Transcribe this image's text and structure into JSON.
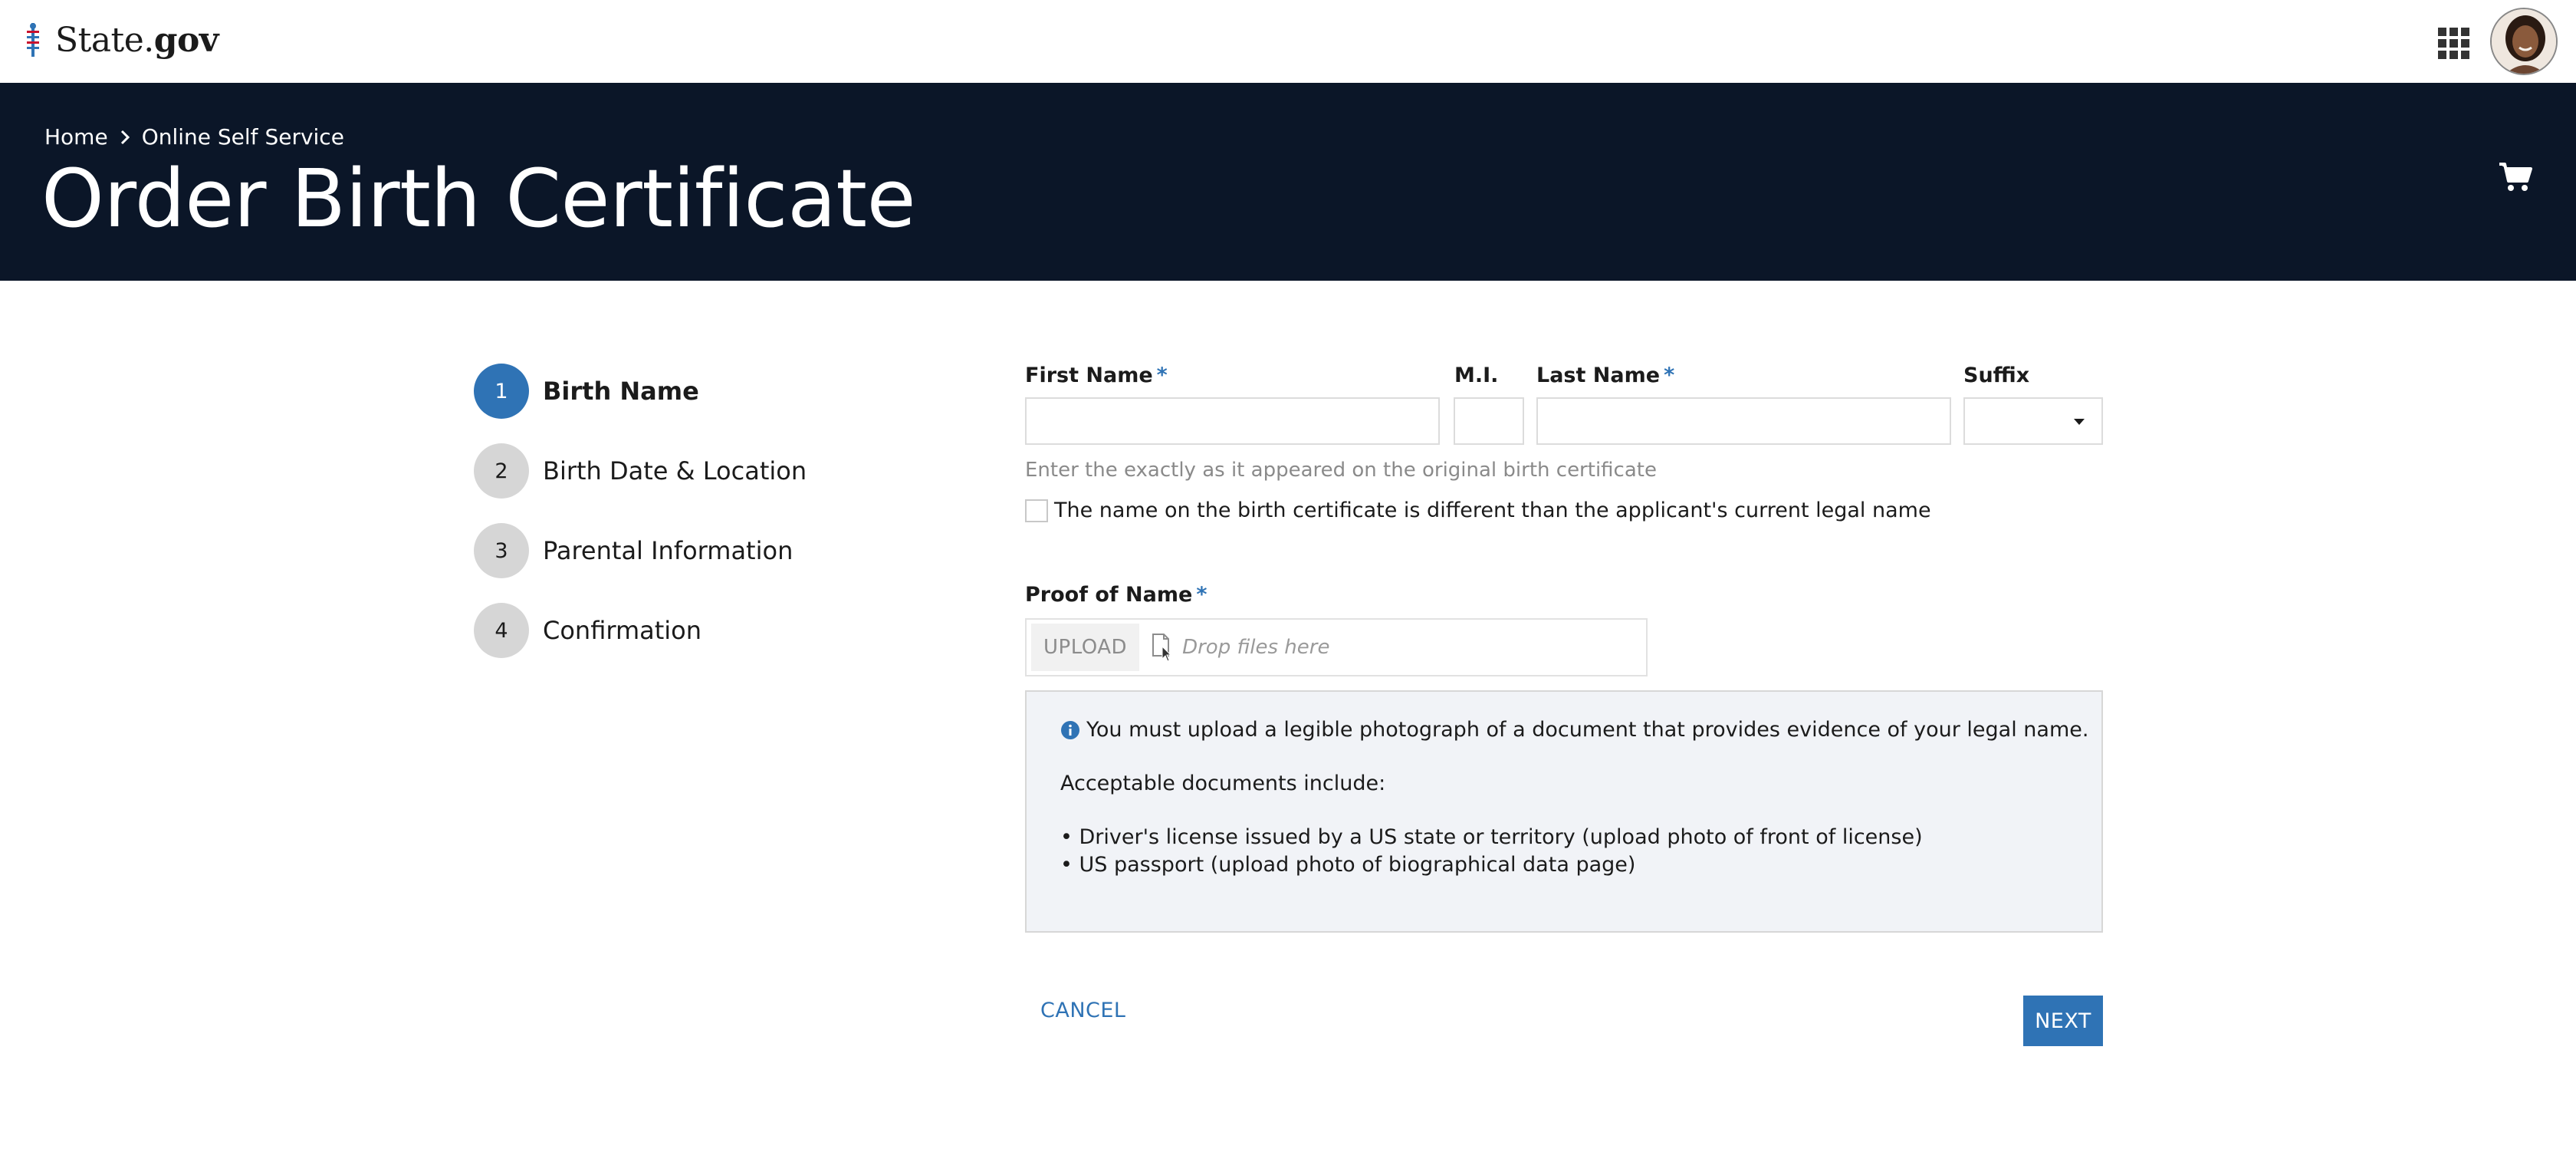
{
  "topbar": {
    "logo_text": "State.",
    "logo_bold": "gov",
    "apps_icon": "apps-grid-icon",
    "avatar_icon": "user-avatar"
  },
  "header": {
    "breadcrumb": [
      "Home",
      "Online Self Service"
    ],
    "title": "Order Birth Certificate",
    "cart_icon": "shopping-cart-icon"
  },
  "steps": [
    {
      "number": "1",
      "label": "Birth Name",
      "active": true
    },
    {
      "number": "2",
      "label": "Birth Date & Location",
      "active": false
    },
    {
      "number": "3",
      "label": "Parental Information",
      "active": false
    },
    {
      "number": "4",
      "label": "Confirmation",
      "active": false
    }
  ],
  "form": {
    "first_name": {
      "label": "First Name",
      "required": "*",
      "value": ""
    },
    "mi": {
      "label": "M.I.",
      "value": ""
    },
    "last_name": {
      "label": "Last Name",
      "required": "*",
      "value": ""
    },
    "suffix": {
      "label": "Suffix",
      "value": ""
    },
    "helper": "Enter the exactly as it appeared on the original birth certificate",
    "different_name_label": "The name on the birth certificate is different than the applicant's current legal name",
    "different_name_checked": false,
    "proof": {
      "label": "Proof of Name",
      "required": "*",
      "upload_label": "UPLOAD",
      "drop_text": "Drop files here"
    },
    "info": {
      "intro": "You must upload a legible photograph of a document that provides evidence of your legal name.",
      "acceptable": "Acceptable documents include:",
      "documents": [
        "• Driver's license issued by a US state or territory (upload photo of front of license)",
        "• US passport (upload photo of biographical data page)"
      ]
    },
    "cancel_label": "CANCEL",
    "next_label": "NEXT"
  },
  "colors": {
    "banner": "#0b1628",
    "accent": "#2f73b5",
    "info_bg": "#f1f3f7",
    "step_inactive": "#d6d6d6"
  }
}
